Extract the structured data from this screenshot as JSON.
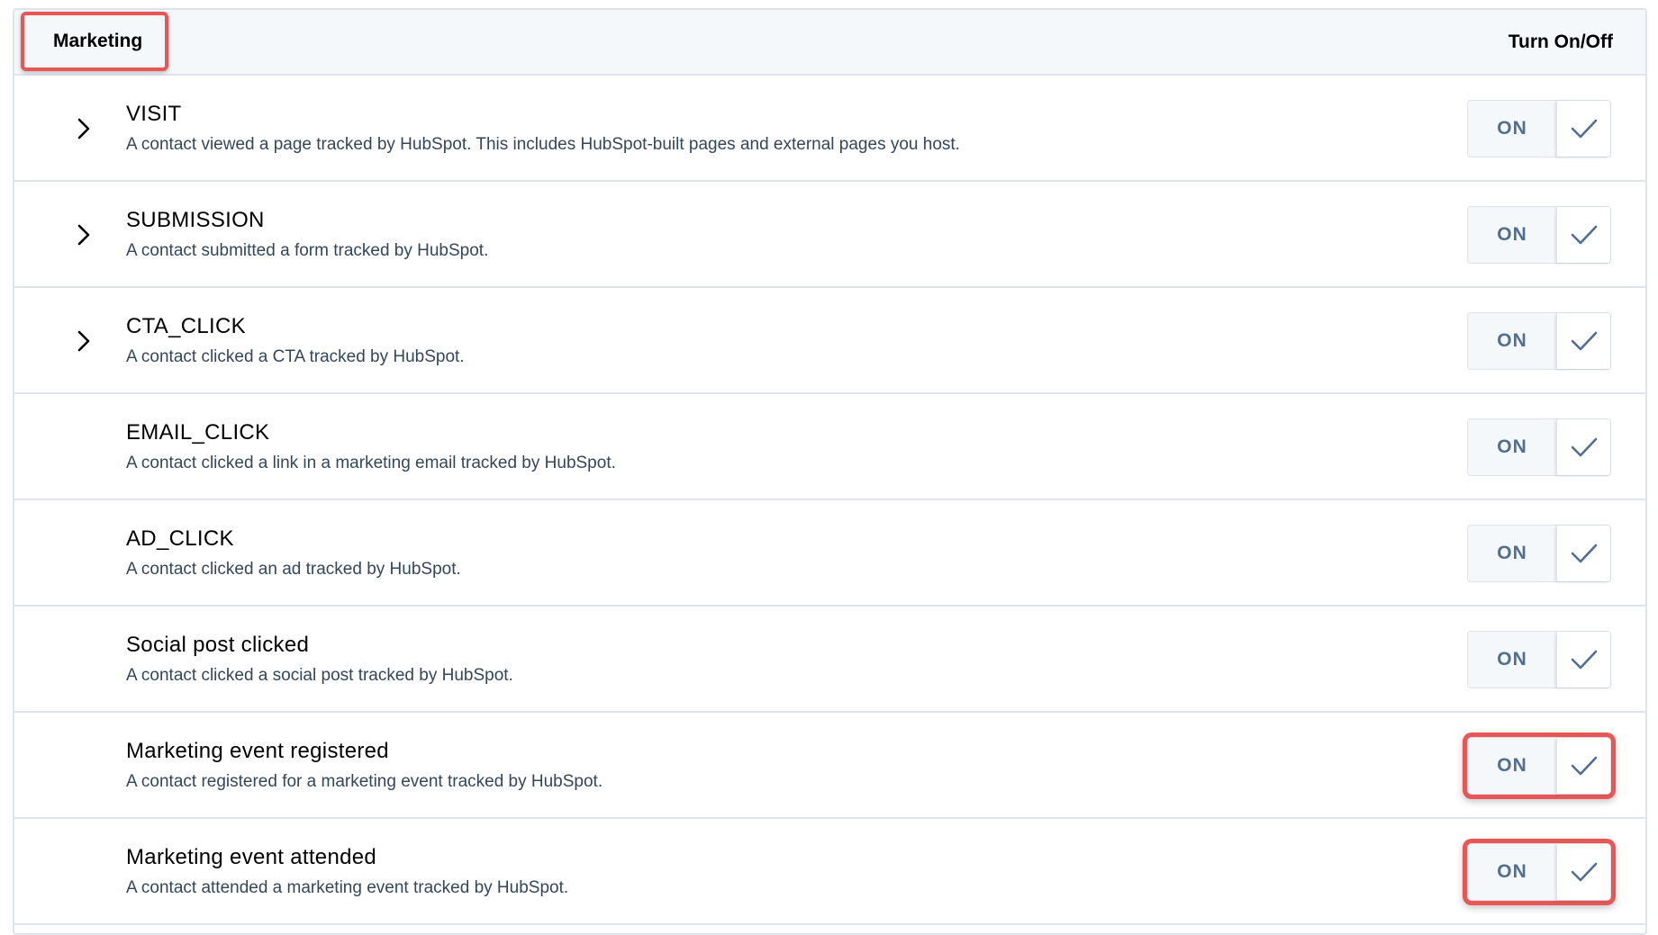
{
  "header": {
    "title": "Marketing",
    "toggle_column_label": "Turn On/Off"
  },
  "colors": {
    "highlight": "#e85656",
    "border": "#dfe3eb",
    "header_bg": "#f5f8fa"
  },
  "rows": [
    {
      "title": "VISIT",
      "description": "A contact viewed a page tracked by HubSpot. This includes HubSpot-built pages and external pages you host.",
      "toggle": "ON",
      "expandable": true,
      "highlighted": false
    },
    {
      "title": "SUBMISSION",
      "description": "A contact submitted a form tracked by HubSpot.",
      "toggle": "ON",
      "expandable": true,
      "highlighted": false
    },
    {
      "title": "CTA_CLICK",
      "description": "A contact clicked a CTA tracked by HubSpot.",
      "toggle": "ON",
      "expandable": true,
      "highlighted": false
    },
    {
      "title": "EMAIL_CLICK",
      "description": "A contact clicked a link in a marketing email tracked by HubSpot.",
      "toggle": "ON",
      "expandable": false,
      "highlighted": false
    },
    {
      "title": "AD_CLICK",
      "description": "A contact clicked an ad tracked by HubSpot.",
      "toggle": "ON",
      "expandable": false,
      "highlighted": false
    },
    {
      "title": "Social post clicked",
      "description": "A contact clicked a social post tracked by HubSpot.",
      "toggle": "ON",
      "expandable": false,
      "highlighted": false
    },
    {
      "title": "Marketing event registered",
      "description": "A contact registered for a marketing event tracked by HubSpot.",
      "toggle": "ON",
      "expandable": false,
      "highlighted": true
    },
    {
      "title": "Marketing event attended",
      "description": "A contact attended a marketing event tracked by HubSpot.",
      "toggle": "ON",
      "expandable": false,
      "highlighted": true
    }
  ]
}
